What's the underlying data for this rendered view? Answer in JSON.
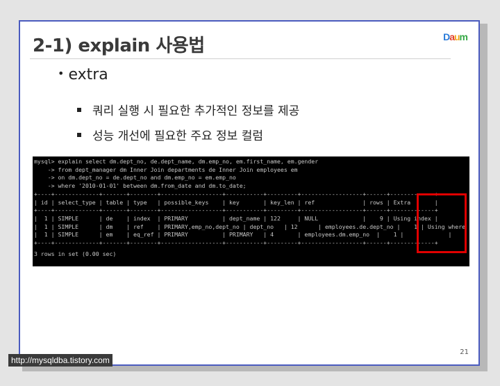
{
  "slide": {
    "title": "2-1) explain 사용법",
    "logo": {
      "p1": "D",
      "p2": "a",
      "p3": "u",
      "p4": "m"
    },
    "bullet": "extra",
    "subbullets": [
      "쿼리 실행 시 필요한 추가적인 정보를 제공",
      "성능 개선에 필요한 주요 정보 컬럼"
    ],
    "page_number": "21"
  },
  "console": {
    "lines": [
      "mysql> explain select dm.dept_no, de.dept_name, dm.emp_no, em.first_name, em.gender",
      "    -> from dept_manager dm Inner Join departments de Inner Join employees em",
      "    -> on dm.dept_no = de.dept_no and dm.emp_no = em.emp_no",
      "    -> where '2010-01-01' between dm.from_date and dm.to_date;",
      "+----+-------------+-------+--------+------------------+-----------+---------+------------------+------+-------------+",
      "| id | select_type | table | type   | possible_keys    | key       | key_len | ref              | rows | Extra       |",
      "+----+-------------+-------+--------+------------------+-----------+---------+------------------+------+-------------+",
      "|  1 | SIMPLE      | de    | index  | PRIMARY          | dept_name | 122     | NULL             |    9 | Using index |",
      "|  1 | SIMPLE      | dm    | ref    | PRIMARY,emp_no,dept_no | dept_no   | 12      | employees.de.dept_no |    1 | Using where |",
      "|  1 | SIMPLE      | em    | eq_ref | PRIMARY          | PRIMARY   | 4       | employees.dm.emp_no  |    1 |             |",
      "+----+-------------+-------+--------+------------------+-----------+---------+------------------+------+-------------+",
      "3 rows in set (0.00 sec)"
    ]
  },
  "watermark": "http://mysqldba.tistory.com"
}
